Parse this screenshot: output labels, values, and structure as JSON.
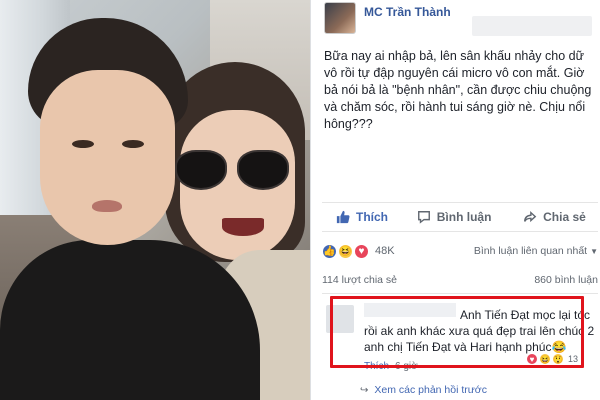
{
  "post": {
    "poster_name": "MC Trần Thành",
    "body": "Bữa nay ai nhập bả, lên sân khấu nhảy cho dữ vô rồi tự đập nguyên cái micro vô con mắt. Giờ bả nói bả là \"bệnh nhân\", cần được chiu chuộng và chăm sóc, rồi hành tui sáng giờ nè. Chịu nổi hông???"
  },
  "actions": {
    "like": "Thích",
    "comment": "Bình luận",
    "share": "Chia sẻ"
  },
  "stats": {
    "reaction_count": "48K",
    "relevant_comments": "Bình luận liên quan nhất",
    "shares": "114 lượt chia sẻ",
    "comments": "860 bình luận"
  },
  "comment": {
    "text": "Anh Tiến Đạt mọc lại tóc rồi ak anh khác xưa quá đẹp trai lên chúc 2 anh chị Tiến Đạt và Hari hạnh phúc😂",
    "reaction_count": "13",
    "meta_prefix": "Thích",
    "time": "6 giờ"
  },
  "more_replies": "Xem các phản hồi trước",
  "colors": {
    "link": "#365899",
    "accent": "#4267b2",
    "highlight": "#e0141c"
  }
}
